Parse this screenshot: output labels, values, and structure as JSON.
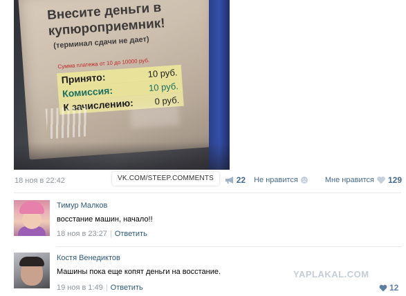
{
  "post": {
    "photo": {
      "screen_title": "Внесите деньги в купюроприемник!",
      "screen_subtitle": "(терминал сдачи не дает)",
      "payment_range": "Сумма платежа от 10 до 10000 руб.",
      "rows": [
        {
          "label": "Принято:",
          "value": "10 руб."
        },
        {
          "label": "Комиссия:",
          "value": "10 руб."
        },
        {
          "label": "К зачислению:",
          "value": "0 руб."
        }
      ]
    },
    "date": "18 ноя в 22:42",
    "watermark": "VK.COM/STEEP.COMMENTS",
    "dislike_count": "22",
    "dislike_label": "Не нравится",
    "like_label": "Мне нравится",
    "like_count": "129"
  },
  "comments": [
    {
      "author": "Тимур Малков",
      "text": "восстание машин, начало!!",
      "date": "18 ноя в 23:27",
      "reply": "Ответить"
    },
    {
      "author": "Костя Венедиктов",
      "text": "Машины пока еще копят деньги на восстание.",
      "date": "19 ноя в 1:49",
      "reply": "Ответить",
      "likes": "12"
    }
  ],
  "site_watermark": "YAPLAKAL.COM",
  "colors": {
    "link": "#2b587a",
    "muted": "#8c949c",
    "divider": "#e7e8ec"
  }
}
